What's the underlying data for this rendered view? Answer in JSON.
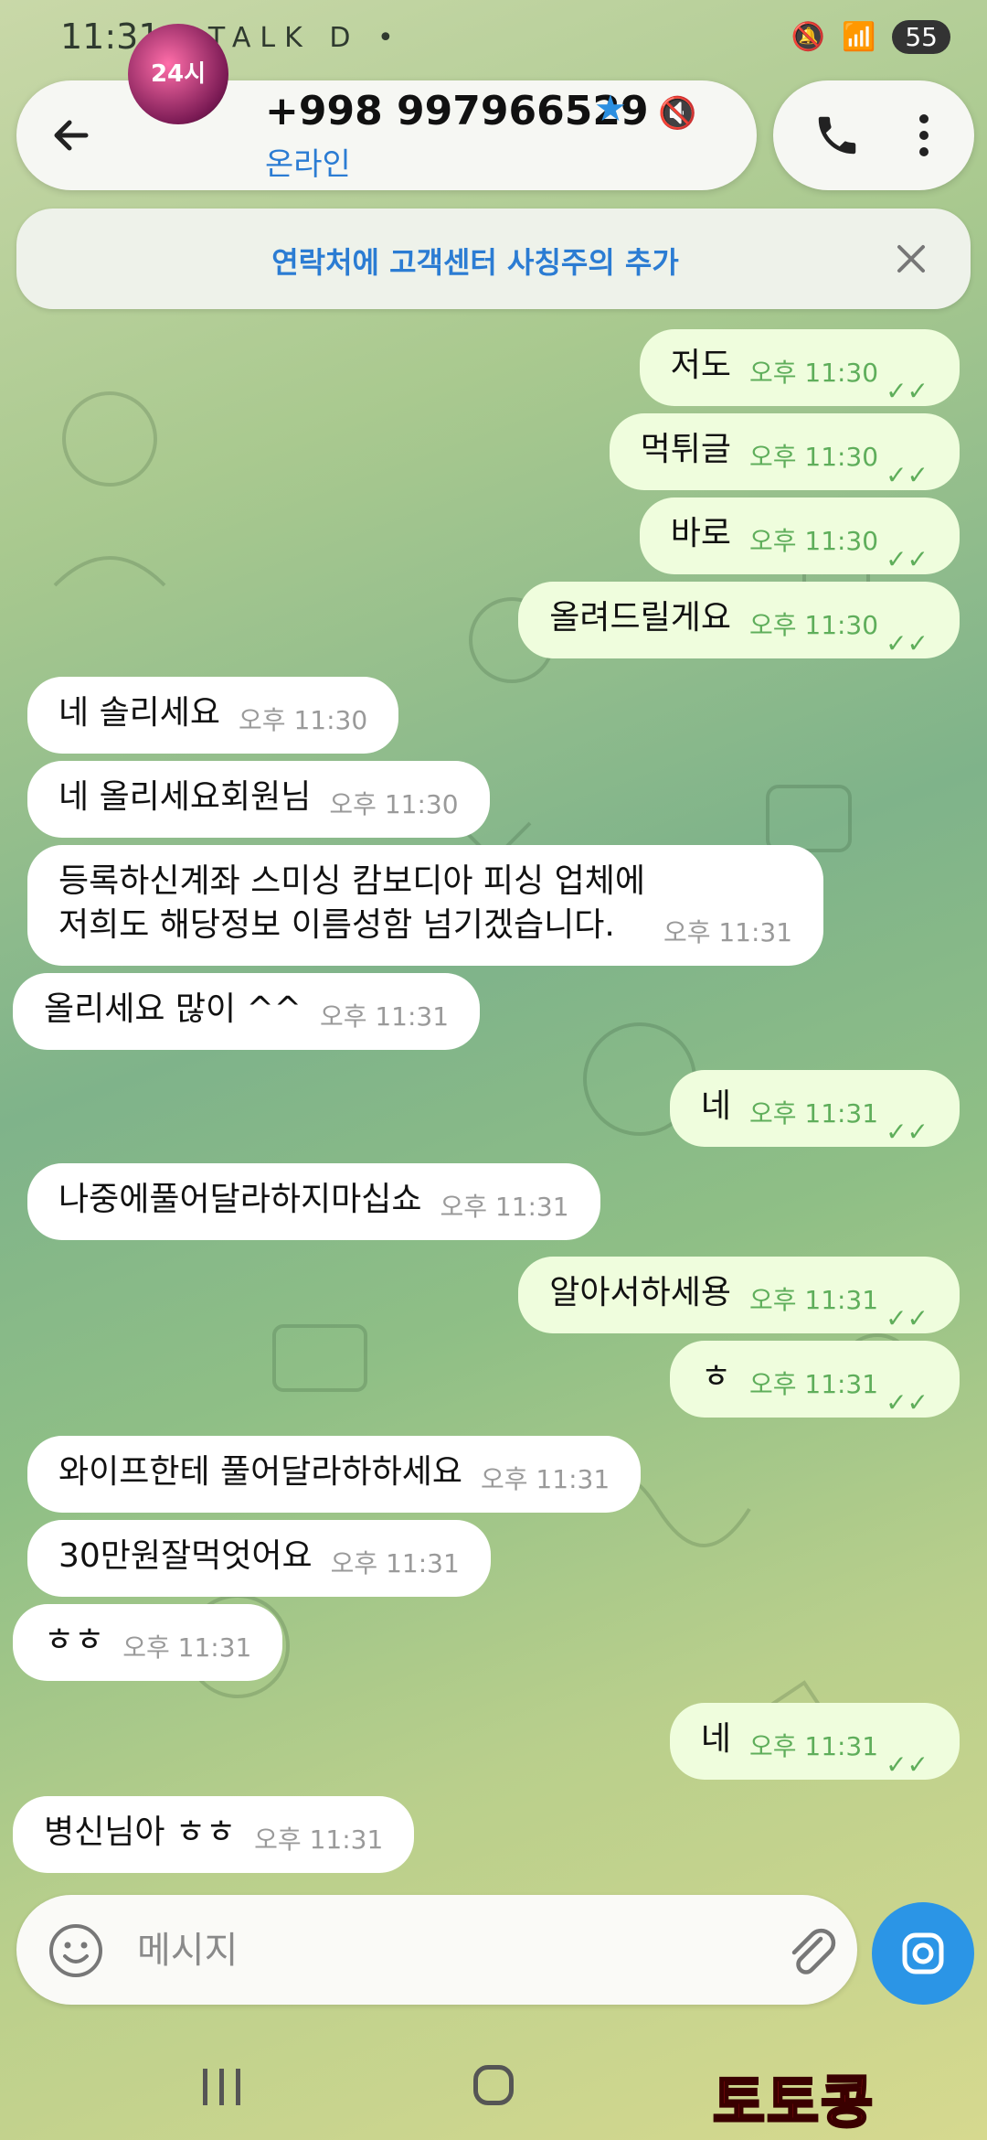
{
  "status_bar": {
    "time": "11:31",
    "icons": "▣ TALK D •",
    "battery": "55"
  },
  "header": {
    "back_icon": "arrow-left-icon",
    "avatar_text": "24시",
    "contact_name": "+998 997966529",
    "contact_status": "온라인",
    "verified_icon": "star-icon",
    "muted_icon": "mute-icon"
  },
  "banner": {
    "text": "연락처에 고객센터 사칭주의 추가"
  },
  "messages": [
    {
      "dir": "out",
      "text": "저도",
      "time": "오후 11:30"
    },
    {
      "dir": "out",
      "text": "먹튀글",
      "time": "오후 11:30"
    },
    {
      "dir": "out",
      "text": "바로",
      "time": "오후 11:30"
    },
    {
      "dir": "out",
      "text": "올려드릴게요",
      "time": "오후 11:30"
    },
    {
      "dir": "in",
      "text": "네 솔리세요",
      "time": "오후 11:30"
    },
    {
      "dir": "in",
      "text": "네 올리세요회원님",
      "time": "오후 11:30"
    },
    {
      "dir": "in",
      "text": "등록하신계좌 스미싱 캄보디아 피싱 업체에\n저희도 해당정보 이름성함 넘기겠습니다.",
      "time": "오후 11:31"
    },
    {
      "dir": "in",
      "text": "올리세요 많이 ^^",
      "time": "오후 11:31"
    },
    {
      "dir": "out",
      "text": "네",
      "time": "오후 11:31"
    },
    {
      "dir": "in",
      "text": "나중에풀어달라하지마십쇼",
      "time": "오후 11:31"
    },
    {
      "dir": "out",
      "text": "알아서하세용",
      "time": "오후 11:31"
    },
    {
      "dir": "out",
      "text": "ㅎ",
      "time": "오후 11:31"
    },
    {
      "dir": "in",
      "text": "와이프한테 풀어달라하하세요",
      "time": "오후 11:31"
    },
    {
      "dir": "in",
      "text": "30만원잘먹엇어요",
      "time": "오후 11:31"
    },
    {
      "dir": "in",
      "text": "ㅎㅎ",
      "time": "오후 11:31"
    },
    {
      "dir": "out",
      "text": "네",
      "time": "오후 11:31"
    },
    {
      "dir": "in",
      "text": "병신님아 ㅎㅎ",
      "time": "오후 11:31"
    }
  ],
  "composer": {
    "placeholder": "메시지"
  },
  "watermark": "토토콩",
  "colors": {
    "accent": "#2b95e6",
    "out_bubble": "#effddd",
    "in_bubble": "#ffffff"
  }
}
